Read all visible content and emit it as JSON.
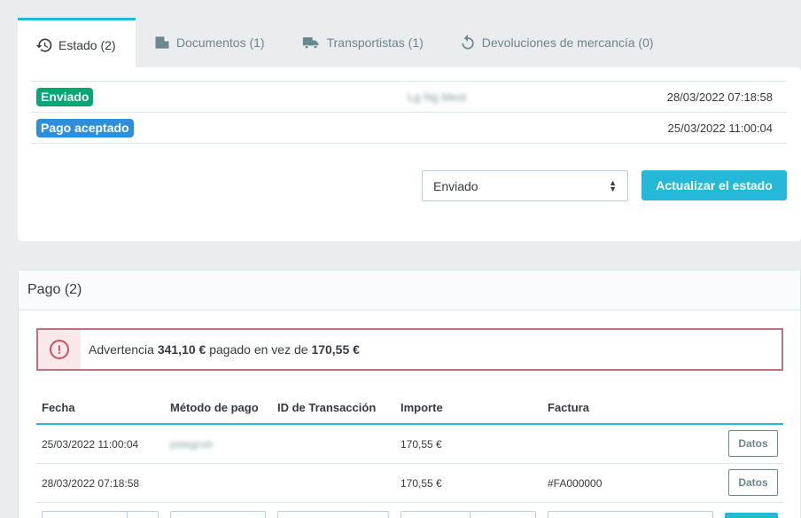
{
  "tabs": [
    {
      "label": "Estado (2)",
      "icon": "history-icon"
    },
    {
      "label": "Documentos (1)",
      "icon": "document-icon"
    },
    {
      "label": "Transportistas (1)",
      "icon": "truck-icon"
    },
    {
      "label": "Devoluciones de mercancía (0)",
      "icon": "return-icon"
    }
  ],
  "history": [
    {
      "status": "Enviado",
      "color": "#00a772",
      "employee": "Lg Ng Mest",
      "date": "28/03/2022 07:18:58"
    },
    {
      "status": "Pago aceptado",
      "color": "#2f8ed9",
      "employee": "",
      "date": "25/03/2022 11:00:04"
    }
  ],
  "status_select": {
    "value": "Enviado"
  },
  "update_button": "Actualizar el estado",
  "payment": {
    "title": "Pago (2)",
    "alert": {
      "prefix": "Advertencia",
      "paid": "341,10 €",
      "middle": "pagado en vez de",
      "expected": "170,55 €"
    },
    "columns": [
      "Fecha",
      "Método de pago",
      "ID de Transacción",
      "Importe",
      "Factura"
    ],
    "rows": [
      {
        "date": "25/03/2022 11:00:04",
        "method": "pstegcsh",
        "transaction": "",
        "amount": "170,55 €",
        "invoice": "",
        "button": "Datos"
      },
      {
        "date": "28/03/2022 07:18:58",
        "method": "",
        "transaction": "",
        "amount": "170,55 €",
        "invoice": "#FA000000",
        "button": "Datos"
      }
    ]
  },
  "colors": {
    "accent": "#25b9d7",
    "success": "#00a772",
    "info": "#2f8ed9",
    "danger": "#c45560"
  }
}
